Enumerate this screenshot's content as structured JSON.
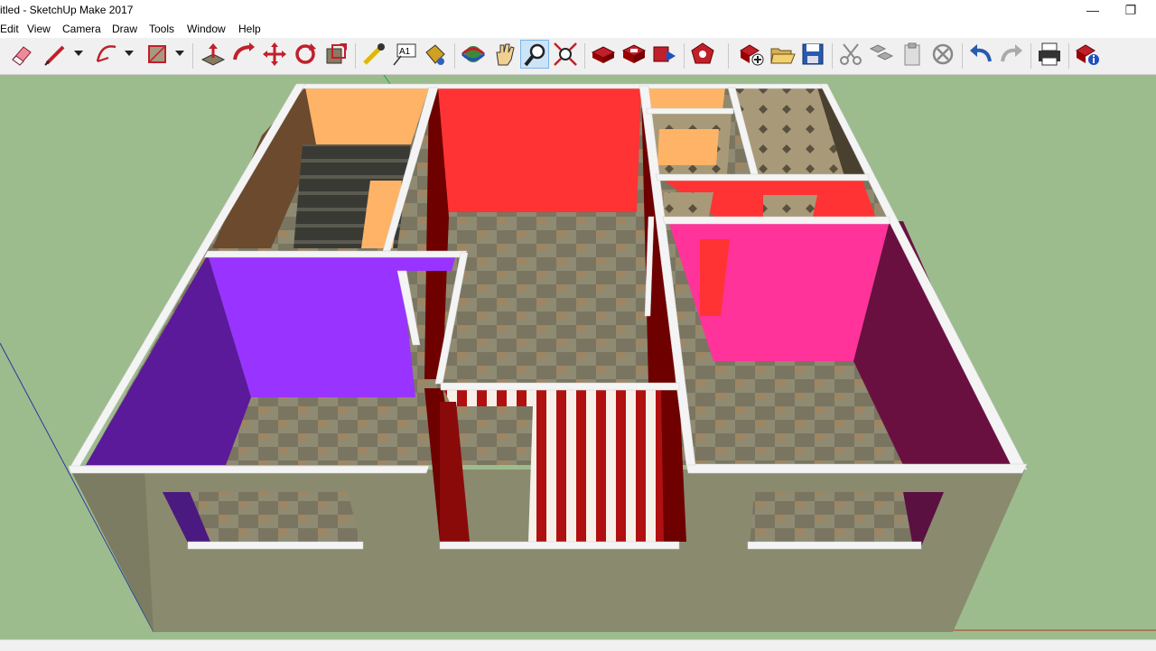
{
  "window": {
    "title": "itled - SketchUp Make 2017",
    "minimize_glyph": "—",
    "restore_glyph": "❐"
  },
  "menu": {
    "items": [
      "Edit",
      "View",
      "Camera",
      "Draw",
      "Tools",
      "Window",
      "Help"
    ]
  },
  "toolbar": {
    "tools": [
      {
        "name": "eraser-icon",
        "tooltip": "Eraser"
      },
      {
        "name": "pencil-icon",
        "tooltip": "Line"
      },
      {
        "name": "arc-icon",
        "tooltip": "Arc"
      },
      {
        "name": "rectangle-icon",
        "tooltip": "Rectangle"
      },
      {
        "name": "push-pull-icon",
        "tooltip": "Push/Pull"
      },
      {
        "name": "follow-me-icon",
        "tooltip": "Follow Me"
      },
      {
        "name": "move-icon",
        "tooltip": "Move"
      },
      {
        "name": "rotate-icon",
        "tooltip": "Rotate"
      },
      {
        "name": "scale-icon",
        "tooltip": "Scale"
      },
      {
        "name": "tape-measure-icon",
        "tooltip": "Tape Measure"
      },
      {
        "name": "text-icon",
        "tooltip": "Text",
        "label": "A1"
      },
      {
        "name": "paint-bucket-icon",
        "tooltip": "Paint Bucket"
      },
      {
        "name": "orbit-icon",
        "tooltip": "Orbit"
      },
      {
        "name": "pan-icon",
        "tooltip": "Pan"
      },
      {
        "name": "zoom-icon",
        "tooltip": "Zoom"
      },
      {
        "name": "zoom-extents-icon",
        "tooltip": "Zoom Extents"
      },
      {
        "name": "warehouse-icon",
        "tooltip": "3D Warehouse"
      },
      {
        "name": "share-model-icon",
        "tooltip": "Share Model"
      },
      {
        "name": "share-component-icon",
        "tooltip": "Share Component"
      },
      {
        "name": "extension-warehouse-icon",
        "tooltip": "Extension Warehouse"
      },
      {
        "name": "new-file-icon",
        "tooltip": "New"
      },
      {
        "name": "open-folder-icon",
        "tooltip": "Open"
      },
      {
        "name": "save-icon",
        "tooltip": "Save"
      },
      {
        "name": "cut-icon",
        "tooltip": "Cut"
      },
      {
        "name": "copy-icon",
        "tooltip": "Copy"
      },
      {
        "name": "paste-icon",
        "tooltip": "Paste"
      },
      {
        "name": "delete-icon",
        "tooltip": "Erase"
      },
      {
        "name": "undo-icon",
        "tooltip": "Undo"
      },
      {
        "name": "redo-icon",
        "tooltip": "Redo"
      },
      {
        "name": "print-icon",
        "tooltip": "Print"
      },
      {
        "name": "model-info-icon",
        "tooltip": "Model Info"
      }
    ]
  },
  "scene": {
    "description_visible": false,
    "colors": {
      "background": "#9dbc8e",
      "outer_wall": "#8a8a6e",
      "wall_top": "#f4f4f4",
      "purple_room": "#9933ff",
      "purple_dark": "#5a1a9a",
      "red_room": "#ff3333",
      "maroon": "#6e0000",
      "pink_room": "#ff3399",
      "pink_dark": "#6a1040",
      "peach": "#ffb366",
      "brown_wall": "#6b4a2e",
      "floor": "#8f8a72",
      "stairs": "#3a3a35"
    }
  }
}
